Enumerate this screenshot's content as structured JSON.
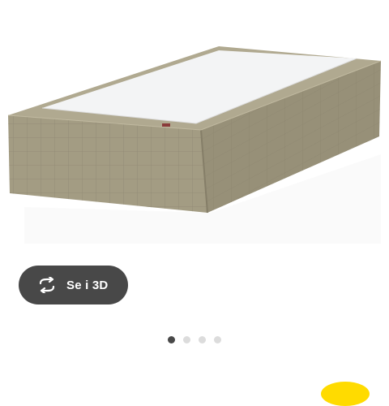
{
  "viewer": {
    "view_3d_label": "Se i 3D",
    "view_3d_icon": "rotate-3d-icon",
    "image_count": 4,
    "active_image_index": 0
  },
  "colors": {
    "button_bg": "#484848",
    "dot_active": "#484848",
    "dot_inactive": "#dcdcdc",
    "accent": "#ffdb00",
    "fabric": "#a59e86"
  }
}
